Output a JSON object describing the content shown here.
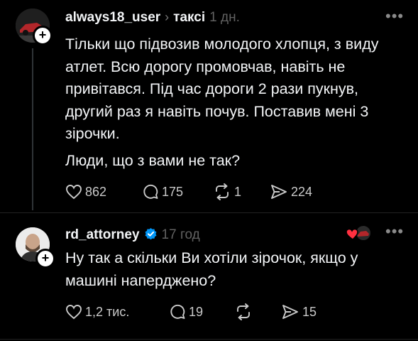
{
  "posts": [
    {
      "username": "always18_user",
      "topic": "таксі",
      "time": "1 дн.",
      "paragraph1": "Тільки що підвозив молодого хлопця, з виду атлет. Всю дорогу промовчав, навіть не привітався. Під час дороги 2 рази пукнув, другий раз я навіть почув. Поставив мені 3 зірочки.",
      "paragraph2": "Люди, що з вами не так?",
      "likes": "862",
      "replies": "175",
      "reposts": "1",
      "shares": "224"
    },
    {
      "username": "rd_attorney",
      "verified": true,
      "time": "17 год",
      "text": "Ну так а скільки Ви хотіли зірочок, якщо у машині наперджено?",
      "likes": "1,2 тис.",
      "replies": "19",
      "shares": "15"
    }
  ],
  "icons": {
    "more": "more-options-icon",
    "like": "heart-icon",
    "reply": "comment-icon",
    "repost": "repost-icon",
    "share": "send-icon",
    "verified": "verified-badge-icon",
    "follow": "plus-icon",
    "liked_by_author": "liked-by-author-icon"
  },
  "colors": {
    "background": "#000000",
    "text": "#f3f5f7",
    "muted": "#616161",
    "verified": "#0095f6",
    "heart": "#ff3040"
  }
}
